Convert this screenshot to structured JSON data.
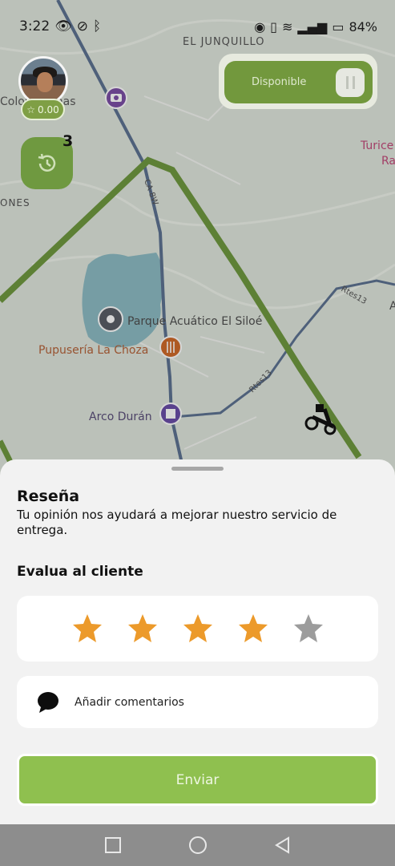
{
  "status": {
    "time": "3:22",
    "battery": "84%"
  },
  "map": {
    "labels": {
      "el_junquillo": "EL JUNQUILLO",
      "colonia_vinas": "Colonia Viñas",
      "turicentro_1": "Turice",
      "turicentro_2": "Ra",
      "ones": "ONES",
      "carretera": "CA-8W",
      "parque": "Parque Acuático El Siloé",
      "pupuseria": "Pupusería La Choza",
      "arco": "Arco Durán",
      "rtes3a": "Rtes13",
      "rtes3b": "Rtes13",
      "edge_a": "A"
    }
  },
  "profile": {
    "rating": "0.00"
  },
  "history": {
    "count": "3"
  },
  "availability": {
    "label": "Disponible"
  },
  "review": {
    "title": "Reseña",
    "subtitle": "Tu opinión nos ayudará a mejorar nuestro servicio de entrega.",
    "evaluate_label": "Evalua al cliente",
    "stars": [
      {
        "filled": true,
        "color": "#ec9a2b"
      },
      {
        "filled": true,
        "color": "#ec9a2b"
      },
      {
        "filled": true,
        "color": "#ec9a2b"
      },
      {
        "filled": true,
        "color": "#ec9a2b"
      },
      {
        "filled": false,
        "color": "#9c9c9c"
      }
    ],
    "comment_label": "Añadir comentarios",
    "send_label": "Enviar"
  },
  "colors": {
    "brand_green": "#72983d",
    "button_green": "#8fc04f",
    "star_orange": "#ec9a2b"
  }
}
